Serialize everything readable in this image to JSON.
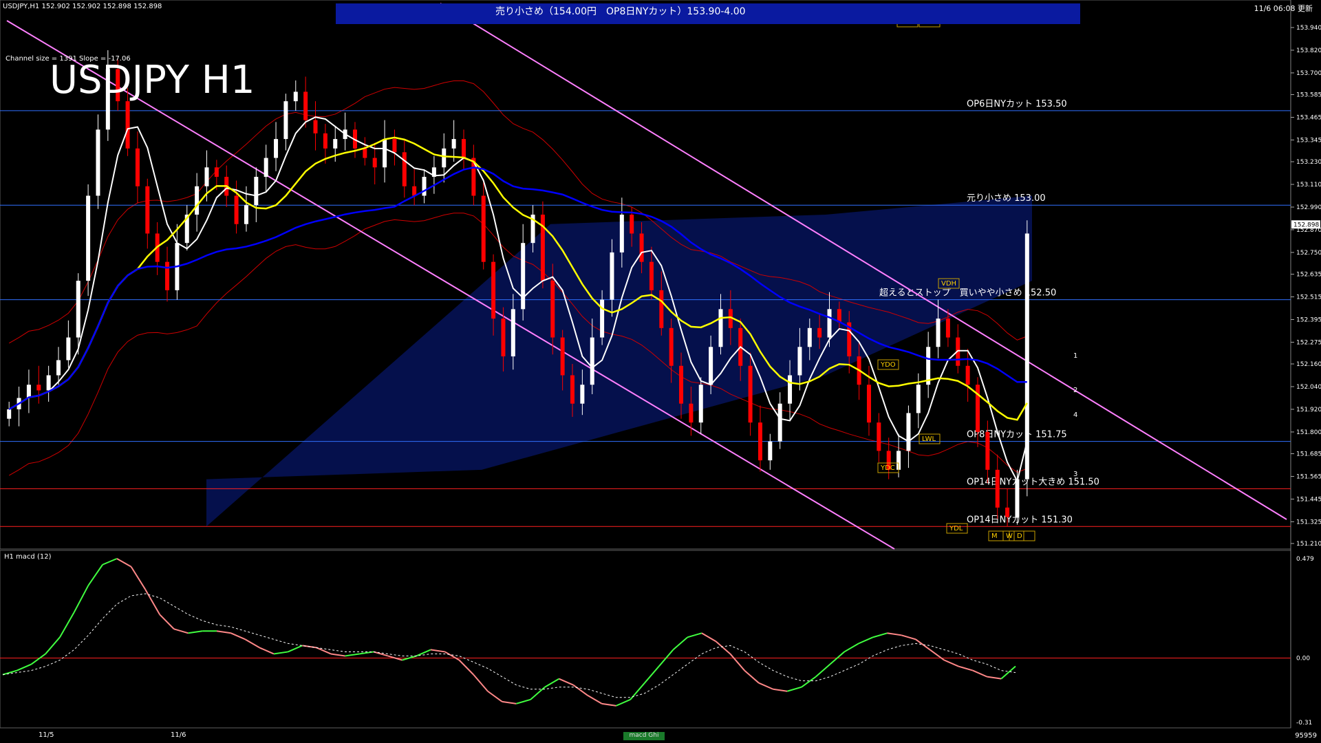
{
  "header": {
    "symbol_info": "USDJPY,H1  152.902 152.902 152.898 152.898",
    "channel_info": "Channel size = 1391 Slope = -17.06",
    "title": "USDJPY H1",
    "timestamp": "11/6 06:08 更新",
    "banner": "売り小さめ（154.00円　OP8日NYカット）153.90-4.00"
  },
  "macd": {
    "label": "H1 macd (12)",
    "tab": "macd Ghi"
  },
  "status": {
    "bars": "95959",
    "dates": [
      "11/5",
      "11/6"
    ]
  },
  "colors": {
    "background": "#000000",
    "bull": "#ffffff",
    "bear": "#ff0000",
    "ma_fast": "#ffffff",
    "ma_mid": "#ffff00",
    "ma_slow": "#0000ff",
    "channel": "#ff80ff",
    "level_line": "#3070ff",
    "red_level": "#ff2020",
    "bollinger": "#d00000",
    "macd_line": "#40ff40",
    "macd_signal": "#ffffff",
    "macd_down": "#ff8888"
  },
  "chart_data": [
    {
      "type": "candlestick",
      "title": "USDJPY H1",
      "ylim": [
        151.21,
        153.94
      ],
      "y_ticks": [
        "153.940",
        "153.820",
        "153.700",
        "153.585",
        "153.465",
        "153.345",
        "153.230",
        "153.110",
        "152.990",
        "152.870",
        "152.750",
        "152.635",
        "152.515",
        "152.395",
        "152.275",
        "152.160",
        "152.040",
        "151.920",
        "151.800",
        "151.685",
        "151.565",
        "151.445",
        "151.325",
        "151.210"
      ],
      "current_price": "152.898",
      "levels": [
        {
          "price": 153.5,
          "label": "OP6日NYカット 153.50"
        },
        {
          "price": 153.0,
          "label": "元り小さめ 153.00"
        },
        {
          "price": 152.5,
          "label": "超えるとストップ　買いやや小さめ 152.50"
        },
        {
          "price": 151.75,
          "label": "OP8日NYカット 151.75"
        },
        {
          "price": 151.5,
          "label": "OP14日NYカット大きめ 151.50"
        },
        {
          "price": 151.3,
          "label": "OP14日NYカット 151.30"
        }
      ],
      "markers": [
        "LMH",
        "LWH",
        "VDH",
        "YDO",
        "YDC",
        "LWL",
        "YDL",
        "M",
        "W",
        "D"
      ],
      "projection_labels": [
        "1",
        "2",
        "3",
        "4"
      ],
      "closes": [
        151.92,
        151.98,
        152.05,
        152.02,
        152.1,
        152.18,
        152.3,
        152.6,
        153.05,
        153.4,
        153.72,
        153.55,
        153.3,
        153.1,
        152.85,
        152.7,
        152.55,
        152.8,
        152.95,
        153.1,
        153.2,
        153.15,
        153.05,
        152.9,
        153.0,
        153.15,
        153.25,
        153.35,
        153.55,
        153.6,
        153.45,
        153.38,
        153.3,
        153.35,
        153.4,
        153.3,
        153.25,
        153.2,
        153.35,
        153.28,
        153.1,
        153.05,
        153.15,
        153.2,
        153.3,
        153.35,
        153.25,
        153.05,
        152.7,
        152.4,
        152.2,
        152.45,
        152.8,
        152.95,
        152.6,
        152.3,
        152.1,
        151.95,
        152.05,
        152.3,
        152.5,
        152.75,
        152.95,
        152.85,
        152.7,
        152.55,
        152.35,
        152.15,
        151.95,
        151.85,
        152.05,
        152.25,
        152.45,
        152.35,
        152.15,
        151.85,
        151.65,
        151.75,
        151.95,
        152.1,
        152.25,
        152.35,
        152.3,
        152.45,
        152.38,
        152.2,
        152.05,
        151.85,
        151.7,
        151.6,
        151.7,
        151.9,
        152.05,
        152.25,
        152.4,
        152.3,
        152.15,
        152.05,
        151.8,
        151.6,
        151.4,
        151.35,
        151.55,
        152.85
      ]
    },
    {
      "type": "line",
      "title": "H1 macd (12)",
      "ylim": [
        -0.31,
        0.479
      ],
      "y_ticks": [
        "0.479",
        "0.00",
        "-0.31"
      ],
      "series": [
        {
          "name": "macd",
          "values": [
            -0.08,
            -0.06,
            -0.03,
            0.02,
            0.1,
            0.22,
            0.35,
            0.45,
            0.479,
            0.44,
            0.33,
            0.21,
            0.14,
            0.12,
            0.13,
            0.13,
            0.12,
            0.09,
            0.05,
            0.02,
            0.03,
            0.06,
            0.05,
            0.02,
            0.01,
            0.02,
            0.03,
            0.01,
            -0.01,
            0.01,
            0.04,
            0.03,
            -0.01,
            -0.08,
            -0.16,
            -0.21,
            -0.22,
            -0.2,
            -0.14,
            -0.1,
            -0.13,
            -0.18,
            -0.22,
            -0.23,
            -0.2,
            -0.12,
            -0.04,
            0.04,
            0.1,
            0.12,
            0.08,
            0.02,
            -0.06,
            -0.12,
            -0.15,
            -0.16,
            -0.14,
            -0.09,
            -0.03,
            0.03,
            0.07,
            0.1,
            0.12,
            0.11,
            0.09,
            0.04,
            -0.01,
            -0.04,
            -0.06,
            -0.09,
            -0.1,
            -0.04
          ]
        },
        {
          "name": "signal",
          "values": [
            -0.08,
            -0.07,
            -0.06,
            -0.04,
            -0.01,
            0.04,
            0.11,
            0.19,
            0.26,
            0.3,
            0.31,
            0.29,
            0.25,
            0.21,
            0.18,
            0.16,
            0.15,
            0.13,
            0.11,
            0.09,
            0.07,
            0.06,
            0.05,
            0.04,
            0.03,
            0.03,
            0.03,
            0.02,
            0.01,
            0.01,
            0.02,
            0.02,
            0.01,
            -0.02,
            -0.05,
            -0.09,
            -0.13,
            -0.15,
            -0.15,
            -0.14,
            -0.14,
            -0.15,
            -0.17,
            -0.19,
            -0.19,
            -0.17,
            -0.13,
            -0.08,
            -0.03,
            0.02,
            0.05,
            0.06,
            0.03,
            -0.02,
            -0.06,
            -0.09,
            -0.11,
            -0.11,
            -0.09,
            -0.06,
            -0.03,
            0.01,
            0.04,
            0.06,
            0.07,
            0.06,
            0.04,
            0.02,
            -0.01,
            -0.03,
            -0.06,
            -0.07
          ]
        }
      ]
    }
  ]
}
